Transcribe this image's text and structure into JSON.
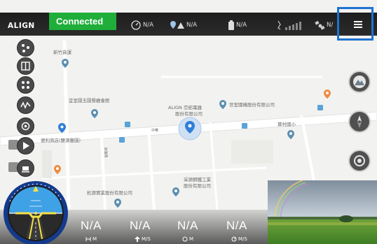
{
  "header": {
    "brand": "ALIGN",
    "connection_status": "Connected",
    "stats": [
      {
        "icon": "gauge-icon",
        "value": "N/A"
      },
      {
        "icon": "home-distance-icon",
        "value": "N/A"
      },
      {
        "icon": "battery-icon",
        "value": "N/A"
      },
      {
        "icon": "signal-icon",
        "value": ""
      },
      {
        "icon": "satellite-icon",
        "value": "N/"
      }
    ]
  },
  "map": {
    "labels": [
      "新竹貨運",
      "宜室園玉園餐廳會館",
      "ALIGN 亞拓電器",
      "股份有限公司",
      "世室國機股份有限公司",
      "便利商店(雙源豐園)",
      "寶村國小",
      "采源鋼鐵工業",
      "股份有限公司",
      "松源實業股份有限公司"
    ],
    "road_labels": [
      "中華",
      "自強路"
    ]
  },
  "telemetry": [
    {
      "value": "N/A",
      "unit": "M",
      "icon": "altitude-icon"
    },
    {
      "value": "N/A",
      "unit": "M/S",
      "icon": "vertical-speed-icon"
    },
    {
      "value": "N/A",
      "unit": "M",
      "icon": "distance-icon"
    },
    {
      "value": "N/A",
      "unit": "M/S",
      "icon": "horizontal-speed-icon"
    }
  ],
  "colors": {
    "connected": "#1fae3a",
    "topbar": "#222222",
    "highlight": "#1e73d2",
    "map_marker": "#5b8fb0",
    "location_dot": "#2f7ed8"
  }
}
